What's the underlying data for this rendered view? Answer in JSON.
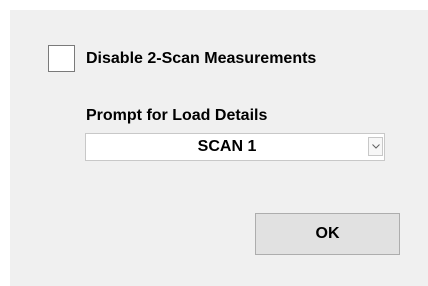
{
  "dialog": {
    "disable_scan_checkbox": {
      "label": "Disable 2-Scan Measurements",
      "checked": false
    },
    "prompt_label": "Prompt for Load Details",
    "scan_select": {
      "value": "SCAN 1",
      "arrow_icon": "chevron-down-icon"
    },
    "ok_label": "OK"
  },
  "colors": {
    "dialog_background": "#f0f0f0",
    "button_background": "#e1e1e1",
    "button_border": "#adadad"
  }
}
